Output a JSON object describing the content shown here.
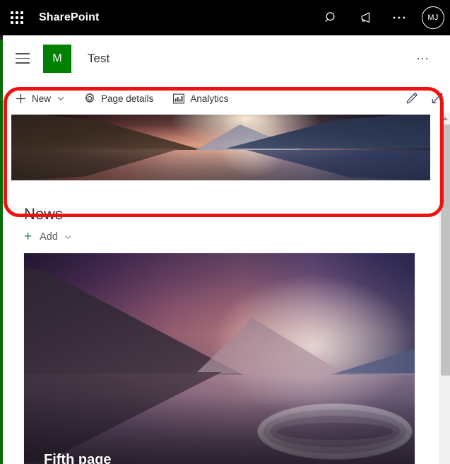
{
  "suite_bar": {
    "waffle_icon": "app-launcher-waffle-icon",
    "title": "SharePoint",
    "search_icon": "search-icon",
    "announcements_icon": "megaphone-icon",
    "more_icon": "ellipsis-icon",
    "avatar_initials": "MJ",
    "background_color": "#000000",
    "text_color": "#ffffff"
  },
  "site_header": {
    "menu_icon": "hamburger-menu-icon",
    "logo_initial": "M",
    "logo_color": "#008000",
    "site_title": "Test",
    "more_icon": "ellipsis-icon"
  },
  "command_bar": {
    "items": [
      {
        "label": "New",
        "icon": "plus-icon",
        "has_chevron": true
      },
      {
        "label": "Page details",
        "icon": "gear-icon",
        "has_chevron": false
      },
      {
        "label": "Analytics",
        "icon": "bar-chart-icon",
        "has_chevron": false
      }
    ],
    "edit_icon": "pencil-edit-icon",
    "expand_icon": "expand-diagonal-arrow-icon"
  },
  "page": {
    "hero": {
      "alt": "misty lake at sunrise with forested mountains reflected in still water"
    },
    "news": {
      "heading": "News",
      "add_label": "Add",
      "add_plus_icon": "plus-icon",
      "add_chevron_icon": "chevron-down-icon",
      "add_plus_color": "#0b8043",
      "cards": [
        {
          "title": "Fifth page",
          "alt": "pink and purple misty lake with mountain reflection and water ripples"
        }
      ]
    }
  },
  "scrollbar": {
    "up_arrow_icon": "scroll-up-arrow-icon",
    "thumb": "scrollbar-thumb"
  },
  "annotation": {
    "shape": "rounded-rectangle-highlight",
    "color": "#ee1111"
  }
}
